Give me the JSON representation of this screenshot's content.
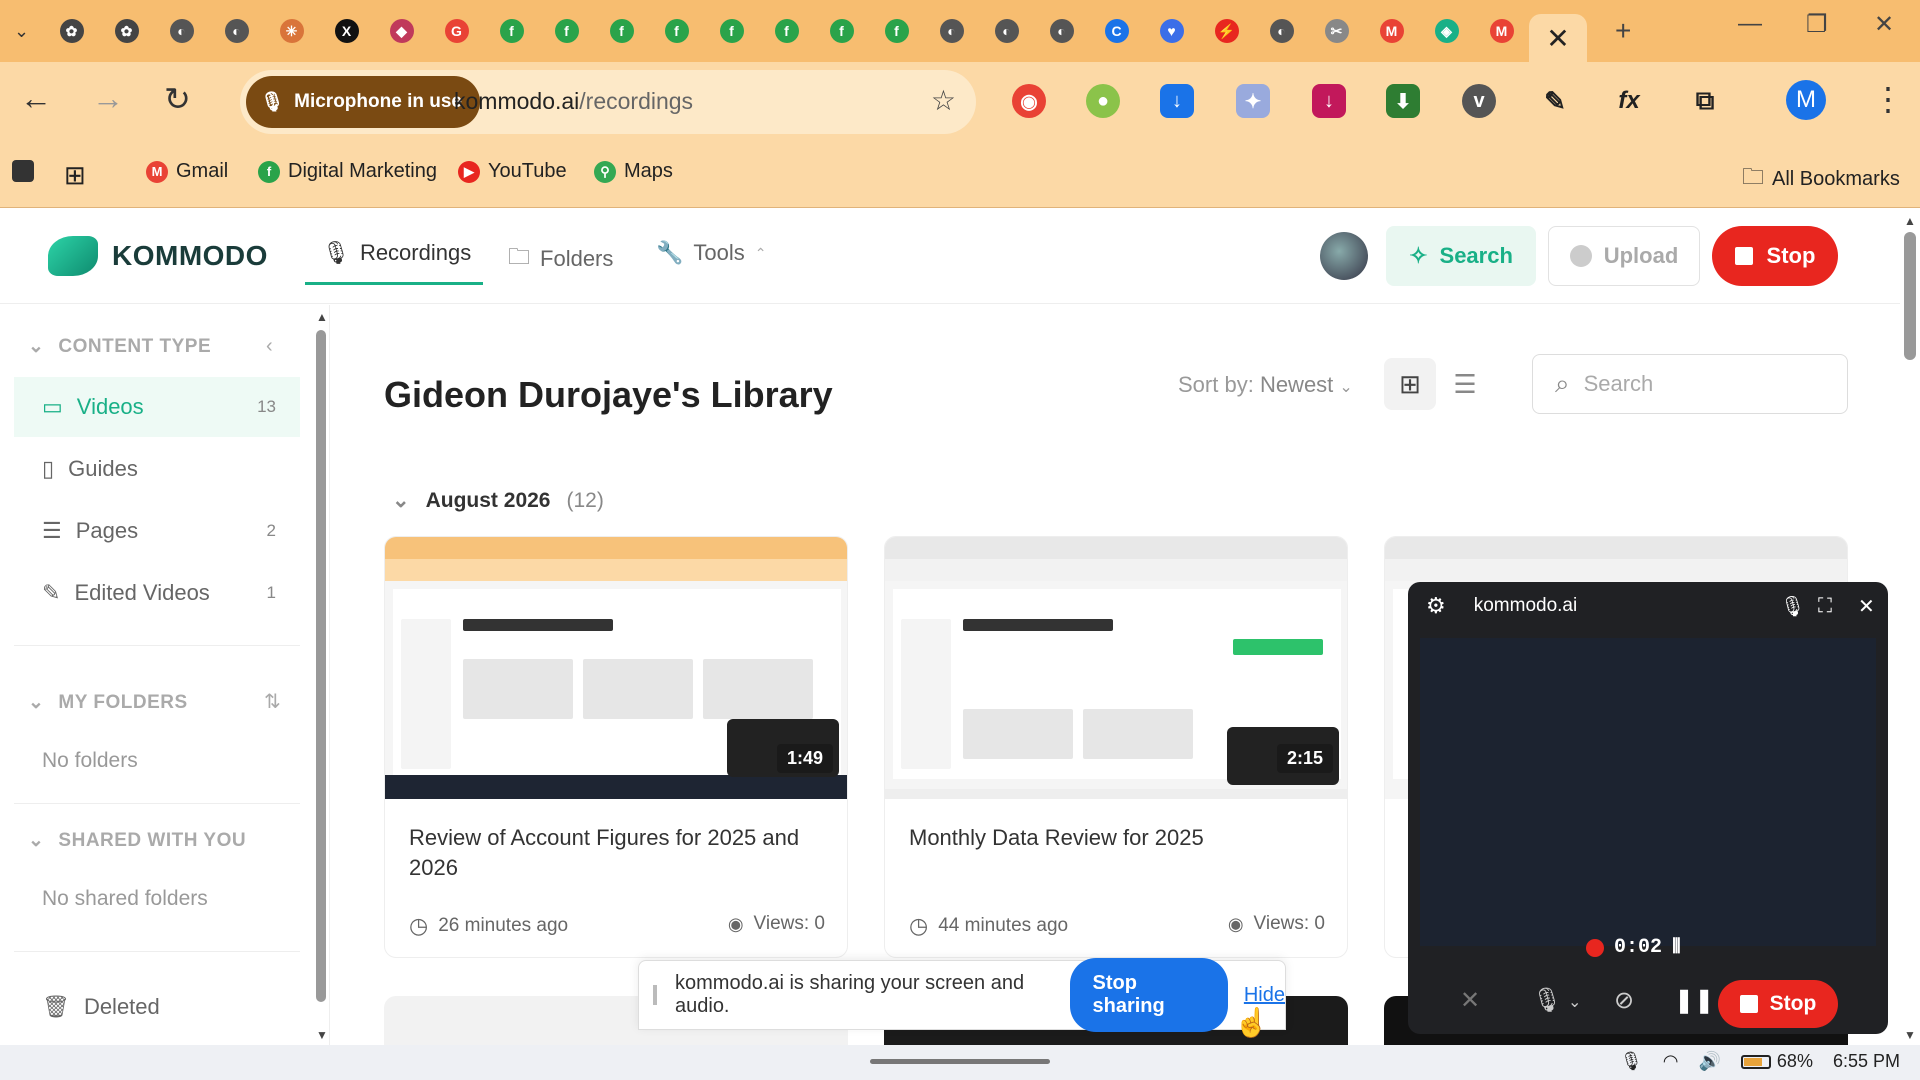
{
  "browser": {
    "tab_icons": [
      {
        "name": "openai-icon",
        "glyph": "✿",
        "color": "#444"
      },
      {
        "name": "openai-icon",
        "glyph": "✿",
        "color": "#444"
      },
      {
        "name": "globe-icon",
        "glyph": "◐",
        "color": "#555"
      },
      {
        "name": "globe-icon",
        "glyph": "◐",
        "color": "#555"
      },
      {
        "name": "claude-icon",
        "glyph": "✳",
        "color": "#d9743a"
      },
      {
        "name": "x-icon",
        "glyph": "X",
        "color": "#111"
      },
      {
        "name": "puzzle-icon",
        "glyph": "◆",
        "color": "#c0395b"
      },
      {
        "name": "google-icon",
        "glyph": "G",
        "color": "#e94235"
      },
      {
        "name": "f-icon",
        "glyph": "f",
        "color": "#2aa34a"
      },
      {
        "name": "f-icon",
        "glyph": "f",
        "color": "#2aa34a"
      },
      {
        "name": "f-icon",
        "glyph": "f",
        "color": "#2aa34a"
      },
      {
        "name": "f-icon",
        "glyph": "f",
        "color": "#2aa34a"
      },
      {
        "name": "f-icon",
        "glyph": "f",
        "color": "#2aa34a"
      },
      {
        "name": "f-icon",
        "glyph": "f",
        "color": "#2aa34a"
      },
      {
        "name": "f-icon",
        "glyph": "f",
        "color": "#2aa34a"
      },
      {
        "name": "f-icon",
        "glyph": "f",
        "color": "#2aa34a"
      },
      {
        "name": "globe-icon",
        "glyph": "◐",
        "color": "#555"
      },
      {
        "name": "globe-icon",
        "glyph": "◐",
        "color": "#555"
      },
      {
        "name": "globe-icon",
        "glyph": "◐",
        "color": "#555"
      },
      {
        "name": "c-icon",
        "glyph": "C",
        "color": "#1a73e8"
      },
      {
        "name": "heart-icon",
        "glyph": "♥",
        "color": "#3b6ee8"
      },
      {
        "name": "bolt-icon",
        "glyph": "⚡",
        "color": "#e8261f"
      },
      {
        "name": "globe-icon",
        "glyph": "◐",
        "color": "#555"
      },
      {
        "name": "tools-icon",
        "glyph": "✂",
        "color": "#888"
      },
      {
        "name": "gmail-icon",
        "glyph": "M",
        "color": "#e94235"
      },
      {
        "name": "shield-icon",
        "glyph": "◈",
        "color": "#19b087"
      },
      {
        "name": "gmail-icon",
        "glyph": "M",
        "color": "#e94235"
      }
    ],
    "mic_chip": "Microphone in use",
    "url_domain": "kommodo.ai",
    "url_path": "/recordings",
    "profile_initial": "M",
    "bookmarks": [
      {
        "label": "Gmail",
        "color": "#e94235",
        "glyph": "M"
      },
      {
        "label": "Digital Marketing",
        "color": "#2aa34a",
        "glyph": "f"
      },
      {
        "label": "YouTube",
        "color": "#e8261f",
        "glyph": "▶"
      },
      {
        "label": "Maps",
        "color": "#34a853",
        "glyph": "⚲"
      }
    ],
    "all_bookmarks": "All Bookmarks"
  },
  "header": {
    "logo": "KOMMODO",
    "tabs": [
      "Recordings",
      "Folders",
      "Tools"
    ],
    "search_label": "Search",
    "upload_label": "Upload",
    "stop_label": "Stop"
  },
  "sidebar": {
    "content_type": "CONTENT TYPE",
    "items": [
      {
        "label": "Videos",
        "count": "13"
      },
      {
        "label": "Guides",
        "count": ""
      },
      {
        "label": "Pages",
        "count": "2"
      },
      {
        "label": "Edited Videos",
        "count": "1"
      }
    ],
    "my_folders": "MY FOLDERS",
    "no_folders": "No folders",
    "shared": "SHARED WITH YOU",
    "no_shared": "No shared folders",
    "deleted": "Deleted"
  },
  "main": {
    "title": "Gideon Durojaye's Library",
    "sort_label": "Sort by:",
    "sort_value": "Newest",
    "search_placeholder": "Search",
    "group": {
      "label": "August 2026",
      "count": "(12)"
    },
    "cards": [
      {
        "title": "Review of Account Figures for 2025 and 2026",
        "duration": "1:49",
        "time": "26 minutes ago",
        "views": "Views: 0"
      },
      {
        "title": "Monthly Data Review for 2025",
        "duration": "2:15",
        "time": "44 minutes ago",
        "views": "Views: 0"
      }
    ]
  },
  "recorder": {
    "site": "kommodo.ai",
    "timer": "0:02",
    "stop_label": "Stop"
  },
  "share_bar": {
    "text": "kommodo.ai is sharing your screen and audio.",
    "stop_sharing": "Stop sharing",
    "hide": "Hide"
  },
  "taskbar": {
    "battery": "68%",
    "time": "6:55 PM"
  },
  "colors": {
    "brand": "#19b087",
    "stop": "#e8261f",
    "chrome": "#fcd9a6",
    "tabstrip": "#f7bd70"
  }
}
